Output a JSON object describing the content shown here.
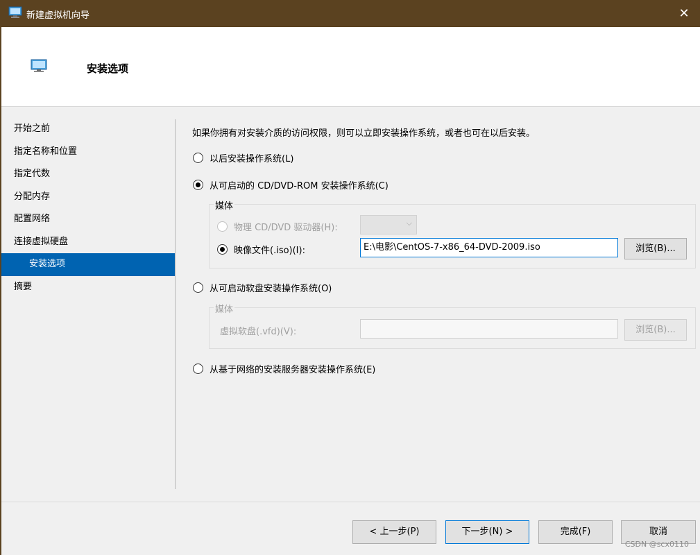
{
  "window": {
    "title": "新建虚拟机向导",
    "close_icon": "close-icon"
  },
  "header": {
    "title": "安装选项"
  },
  "nav": {
    "items": [
      {
        "label": "开始之前"
      },
      {
        "label": "指定名称和位置"
      },
      {
        "label": "指定代数"
      },
      {
        "label": "分配内存"
      },
      {
        "label": "配置网络"
      },
      {
        "label": "连接虚拟硬盘"
      },
      {
        "label": "安装选项",
        "selected": true
      },
      {
        "label": "摘要"
      }
    ]
  },
  "content": {
    "intro": "如果你拥有对安装介质的访问权限，则可以立即安装操作系统，或者也可在以后安装。",
    "options": {
      "later": {
        "label": "以后安装操作系统(L)",
        "checked": false
      },
      "cd_dvd": {
        "label": "从可启动的 CD/DVD-ROM 安装操作系统(C)",
        "checked": true
      },
      "floppy": {
        "label": "从可启动软盘安装操作系统(O)",
        "checked": false
      },
      "network": {
        "label": "从基于网络的安装服务器安装操作系统(E)",
        "checked": false
      }
    },
    "cd_media": {
      "group_label": "媒体",
      "physical_label": "物理 CD/DVD 驱动器(H):",
      "physical_checked": false,
      "image_label": "映像文件(.iso)(I):",
      "image_checked": true,
      "image_path": "E:\\电影\\CentOS-7-x86_64-DVD-2009.iso",
      "browse_label": "浏览(B)..."
    },
    "floppy_media": {
      "group_label": "媒体",
      "vfd_label": "虚拟软盘(.vfd)(V):",
      "vfd_path": "",
      "browse_label": "浏览(B)..."
    }
  },
  "footer": {
    "prev": "< 上一步(P)",
    "next": "下一步(N) >",
    "finish": "完成(F)",
    "cancel": "取消"
  },
  "watermark": "CSDN @scx0110",
  "colors": {
    "titlebar": "#5b4220",
    "selected": "#0063b1",
    "focus": "#0078d7"
  }
}
